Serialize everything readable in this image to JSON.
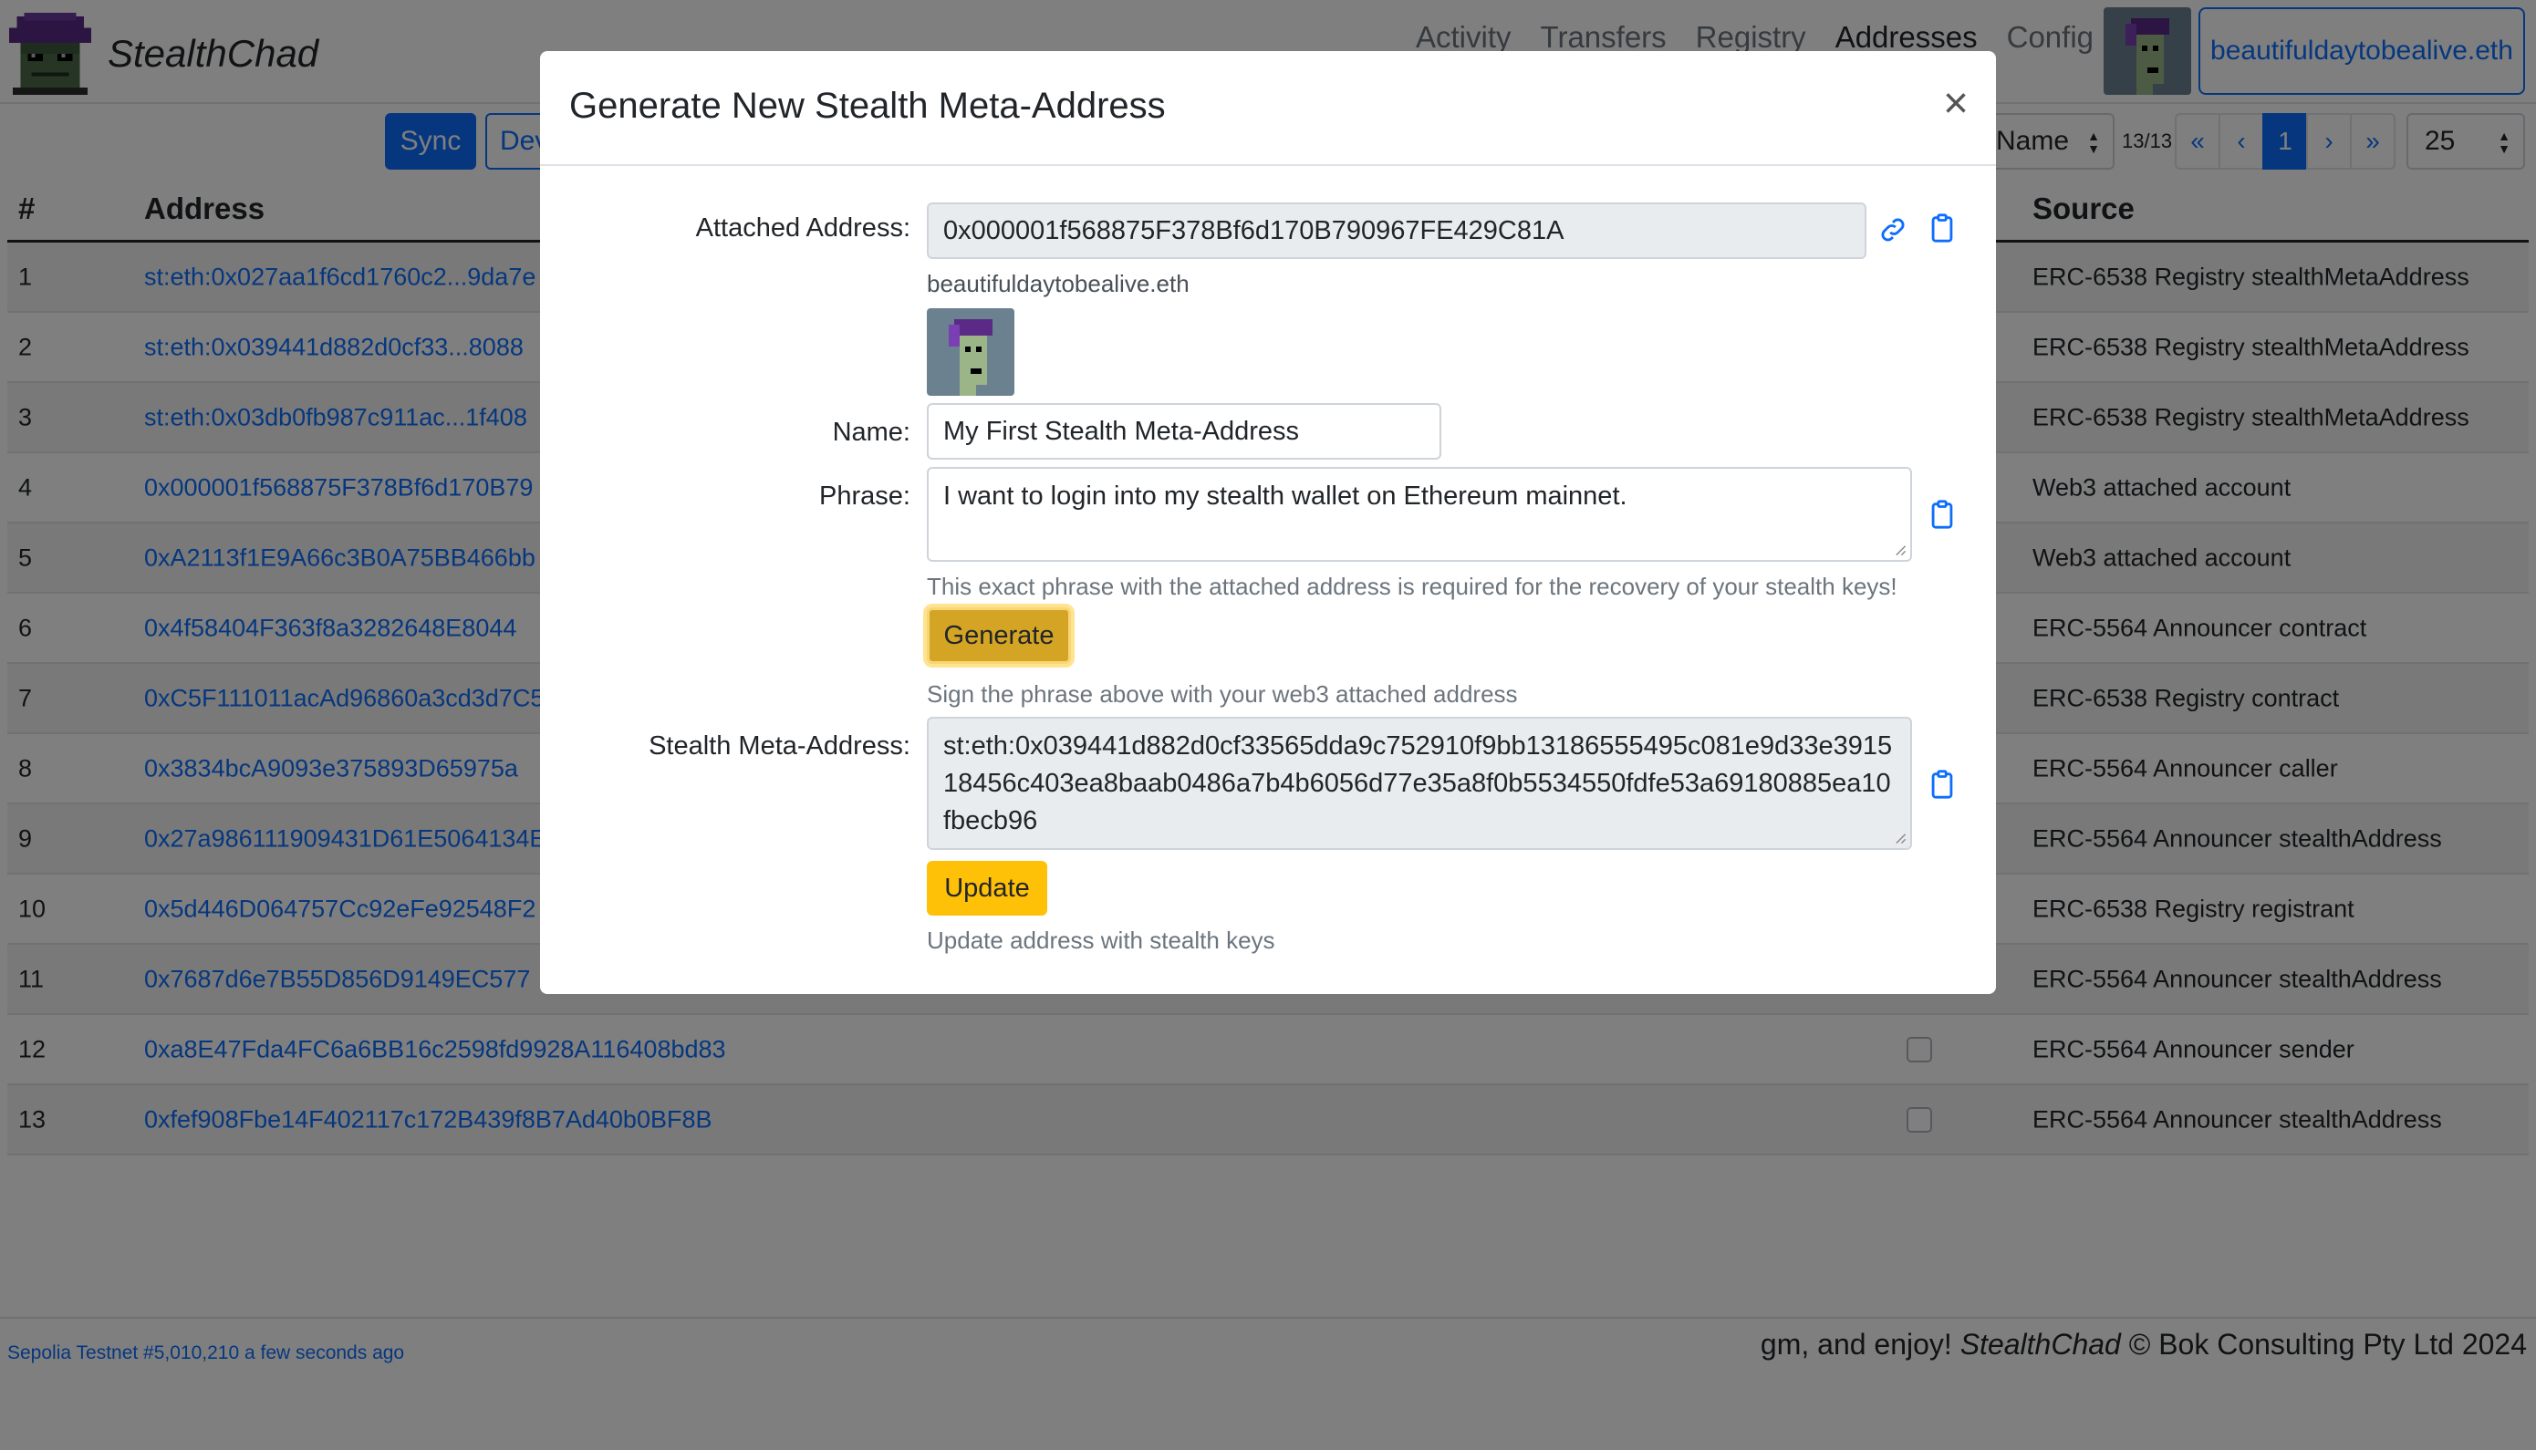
{
  "app": {
    "brand": "StealthChad"
  },
  "nav": {
    "links": [
      "Activity",
      "Transfers",
      "Registry",
      "Addresses",
      "Config"
    ],
    "active": "Addresses",
    "ens": "beautifuldaytobealive.eth"
  },
  "toolbar": {
    "sync_label": "Sync",
    "dev_label": "Dev",
    "sort_value": "Name",
    "page_count": "13/13",
    "pager": [
      "«",
      "‹",
      "1",
      "›",
      "»"
    ],
    "page_size": "25"
  },
  "table": {
    "headers": {
      "num": "#",
      "address": "Address",
      "source": "Source"
    },
    "rows": [
      {
        "num": "1",
        "address": "st:eth:0x027aa1f6cd1760c2...9da7e",
        "source": "ERC-6538 Registry stealthMetaAddress"
      },
      {
        "num": "2",
        "address": "st:eth:0x039441d882d0cf33...8088",
        "source": "ERC-6538 Registry stealthMetaAddress"
      },
      {
        "num": "3",
        "address": "st:eth:0x03db0fb987c911ac...1f408",
        "source": "ERC-6538 Registry stealthMetaAddress"
      },
      {
        "num": "4",
        "address": "0x000001f568875F378Bf6d170B79",
        "source": "Web3 attached account"
      },
      {
        "num": "5",
        "address": "0xA2113f1E9A66c3B0A75BB466bb",
        "source": "Web3 attached account"
      },
      {
        "num": "6",
        "address": "0x4f58404F363f8a3282648E8044",
        "source": "ERC-5564 Announcer contract"
      },
      {
        "num": "7",
        "address": "0xC5F111011acAd96860a3cd3d7C5",
        "source": "ERC-6538 Registry contract"
      },
      {
        "num": "8",
        "address": "0x3834bcA9093e375893D65975a",
        "source": "ERC-5564 Announcer caller"
      },
      {
        "num": "9",
        "address": "0x27a986111909431D61E5064134E",
        "source": "ERC-5564 Announcer stealthAddress"
      },
      {
        "num": "10",
        "address": "0x5d446D064757Cc92eFe92548F2",
        "source": "ERC-6538 Registry registrant"
      },
      {
        "num": "11",
        "address": "0x7687d6e7B55D856D9149EC577",
        "source": "ERC-5564 Announcer stealthAddress"
      },
      {
        "num": "12",
        "address": "0xa8E47Fda4FC6a6BB16c2598fd9928A116408bd83",
        "source": "ERC-5564 Announcer sender"
      },
      {
        "num": "13",
        "address": "0xfef908Fbe14F402117c172B439f8B7Ad40b0BF8B",
        "source": "ERC-5564 Announcer stealthAddress"
      }
    ]
  },
  "footer": {
    "left": "Sepolia Testnet #5,010,210 a few seconds ago",
    "right_prefix": "gm, and enjoy! ",
    "right_brand": "StealthChad",
    "right_suffix": " © Bok Consulting Pty Ltd 2024"
  },
  "modal": {
    "title": "Generate New Stealth Meta-Address",
    "close": "×",
    "attached_label": "Attached Address:",
    "attached_value": "0x000001f568875F378Bf6d170B790967FE429C81A",
    "attached_ens": "beautifuldaytobealive.eth",
    "name_label": "Name:",
    "name_value": "My First Stealth Meta-Address",
    "phrase_label": "Phrase:",
    "phrase_value": "I want to login into my stealth wallet on Ethereum mainnet.",
    "phrase_help": "This exact phrase with the attached address is required for the recovery of your stealth keys!",
    "generate_label": "Generate",
    "generate_help": "Sign the phrase above with your web3 attached address",
    "sma_label": "Stealth Meta-Address:",
    "sma_value": "st:eth:0x039441d882d0cf33565dda9c752910f9bb13186555495c081e9d33e391518456c403ea8baab0486a7b4b6056d77e35a8f0b5534550fdfe53a69180885ea10fbecb96",
    "update_label": "Update",
    "update_help": "Update address with stealth keys"
  },
  "colors": {
    "primary": "#0d6efd",
    "warning": "#ffc107",
    "backdrop": "rgba(0,0,0,0.5)"
  }
}
